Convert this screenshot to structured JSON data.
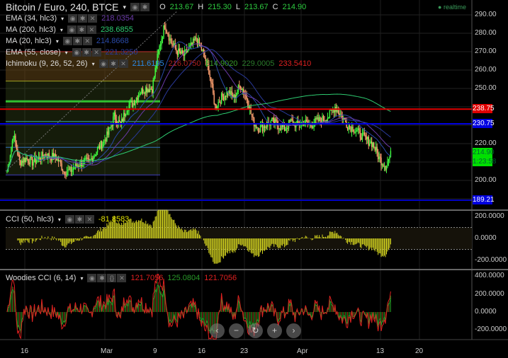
{
  "header": {
    "symbol": "Bitcoin / Euro, 240, BTCE",
    "ohlc": {
      "o_label": "O",
      "o": "213.67",
      "h_label": "H",
      "h": "215.30",
      "l_label": "L",
      "l": "213.67",
      "c_label": "C",
      "c": "214.90"
    },
    "realtime": "realtime"
  },
  "indicators": [
    {
      "label": "EMA (34, hlc3)",
      "value": "218.0354",
      "color": "#6a3aa8"
    },
    {
      "label": "MA (200, hlc3)",
      "value": "238.6855",
      "color": "#2ecc71"
    },
    {
      "label": "MA (20, hlc3)",
      "value": "214.8668",
      "color": "#2a4aa8"
    },
    {
      "label": "EMA (55, close)",
      "value": "221.3250",
      "color": "#2a3a9a"
    },
    {
      "label": "Ichimoku (9, 26, 52, 26)",
      "values": [
        "211.6195",
        "216.0750",
        "214.9020",
        "229.0005",
        "233.5410"
      ],
      "colors": [
        "#2a8ae8",
        "#b02020",
        "#3a9a2a",
        "#2a7a2a",
        "#e02020"
      ]
    }
  ],
  "cci": {
    "label": "CCI (50, hlc3)",
    "value": "-81.8583",
    "ticks": [
      "200.0000",
      "0.0000",
      "-200.0000"
    ]
  },
  "woodies": {
    "label": "Woodies CCI (6, 14)",
    "values": [
      "121.7056",
      "125.0804",
      "121.7056"
    ],
    "colors": [
      "#e02020",
      "#2a9a2a",
      "#e02020"
    ],
    "ticks": [
      "400.0000",
      "200.0000",
      "0.0000",
      "-200.0000"
    ]
  },
  "price_tags": [
    {
      "value": "238.75",
      "color": "#e00000"
    },
    {
      "value": "230.75",
      "color": "#0000e0"
    },
    {
      "value": "214.90",
      "color": "#00e000"
    },
    {
      "value": "1:23:58",
      "color": "#00e000"
    },
    {
      "value": "189.21",
      "color": "#0000e0"
    }
  ],
  "nav_buttons": [
    "‹",
    "−",
    "↻",
    "+",
    "›"
  ],
  "chart_data": {
    "type": "candlestick",
    "interval": "240",
    "y_ticks": [
      "290.00",
      "280.00",
      "270.00",
      "260.00",
      "250.00",
      "220.00",
      "200.00"
    ],
    "ylim": [
      187,
      298
    ],
    "x_ticks": [
      "16",
      "Mar",
      "9",
      "16",
      "23",
      "Apr",
      "13",
      "20"
    ],
    "daily_close": [
      205,
      225,
      210,
      212,
      210,
      212,
      214,
      213,
      212,
      205,
      205,
      208,
      210,
      210,
      215,
      220,
      225,
      235,
      230,
      240,
      242,
      248,
      250,
      250,
      270,
      285,
      275,
      270,
      268,
      272,
      277,
      270,
      260,
      240,
      245,
      248,
      245,
      252,
      245,
      232,
      228,
      230,
      232,
      230,
      228,
      232,
      230,
      232,
      230,
      232,
      233,
      235,
      240,
      235,
      230,
      228,
      225,
      222,
      220,
      212,
      208,
      215
    ],
    "horizontal_lines": [
      {
        "price": 238.75,
        "color": "#e00000"
      },
      {
        "price": 230.75,
        "color": "#0000e0"
      },
      {
        "price": 189.21,
        "color": "#0000c0"
      }
    ]
  }
}
